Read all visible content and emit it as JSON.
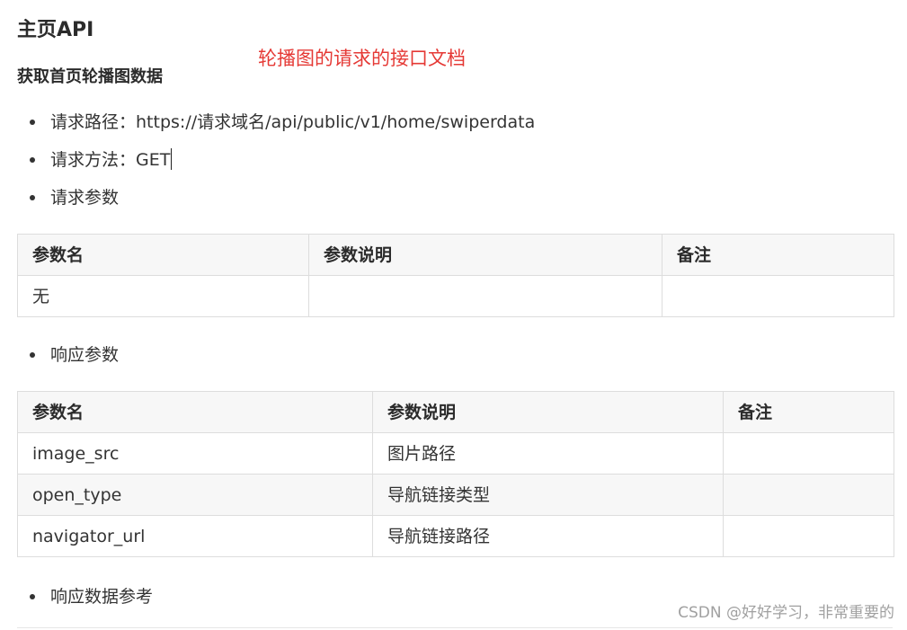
{
  "doc": {
    "title": "主页API",
    "annotation": "轮播图的请求的接口文档",
    "section_title": "获取首页轮播图数据",
    "request_items": [
      {
        "label": "请求路径：",
        "value": "https://请求域名/api/public/v1/home/swiperdata"
      },
      {
        "label": "请求方法：",
        "value": "GET"
      },
      {
        "label": "请求参数",
        "value": ""
      }
    ],
    "request_table": {
      "headers": [
        "参数名",
        "参数说明",
        "备注"
      ],
      "rows": [
        [
          "无",
          "",
          ""
        ]
      ]
    },
    "response_item": "响应参数",
    "response_table": {
      "headers": [
        "参数名",
        "参数说明",
        "备注"
      ],
      "rows": [
        [
          "image_src",
          "图片路径",
          ""
        ],
        [
          "open_type",
          "导航链接类型",
          ""
        ],
        [
          "navigator_url",
          "导航链接路径",
          ""
        ]
      ]
    },
    "response_example_item": "响应数据参考",
    "watermark": "CSDN @好好学习，非常重要的"
  }
}
